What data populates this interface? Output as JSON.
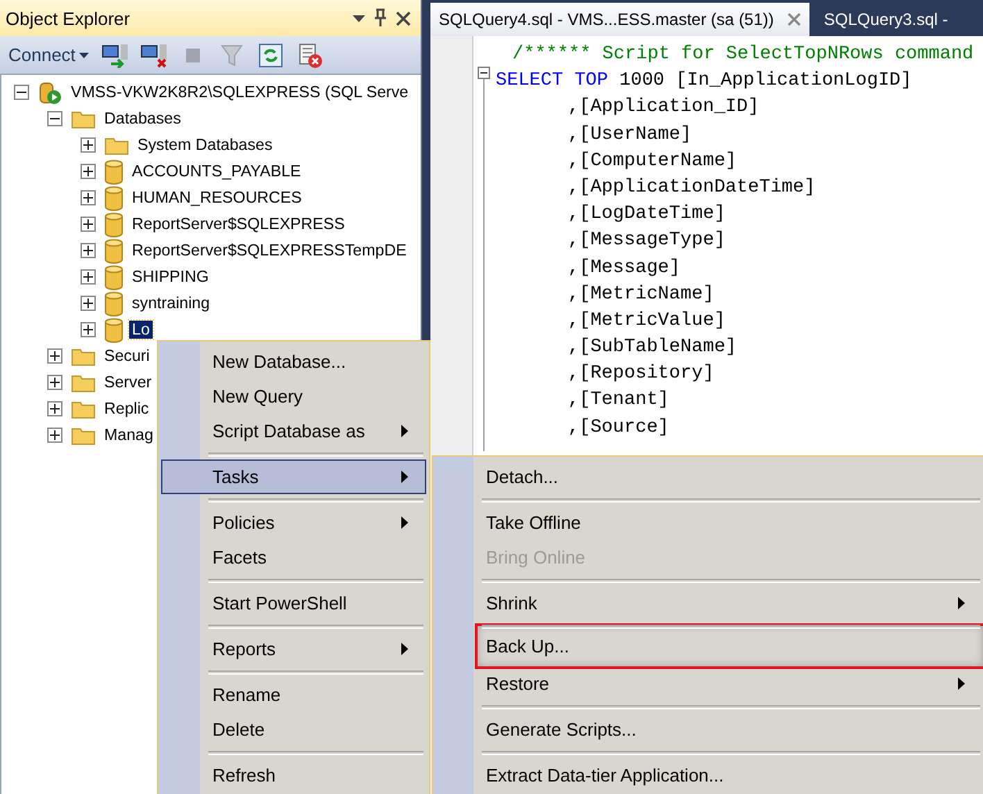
{
  "explorer": {
    "title": "Object Explorer",
    "connect_label": "Connect",
    "tree": [
      {
        "label": "VMSS-VKW2K8R2\\SQLEXPRESS (SQL Serve",
        "kind": "server",
        "expanded": true,
        "selected": false,
        "children": [
          {
            "label": "Databases",
            "kind": "folder",
            "expanded": true,
            "selected": false,
            "children": [
              {
                "label": "System Databases",
                "kind": "folder",
                "expanded": false,
                "selected": false
              },
              {
                "label": "ACCOUNTS_PAYABLE",
                "kind": "database",
                "expanded": false,
                "selected": false
              },
              {
                "label": "HUMAN_RESOURCES",
                "kind": "database",
                "expanded": false,
                "selected": false
              },
              {
                "label": "ReportServer$SQLEXPRESS",
                "kind": "database",
                "expanded": false,
                "selected": false
              },
              {
                "label": "ReportServer$SQLEXPRESSTempDE",
                "kind": "database",
                "expanded": false,
                "selected": false
              },
              {
                "label": "SHIPPING",
                "kind": "database",
                "expanded": false,
                "selected": false
              },
              {
                "label": "syntraining",
                "kind": "database",
                "expanded": false,
                "selected": false
              },
              {
                "label": "Lo",
                "kind": "database",
                "expanded": false,
                "selected": true
              }
            ]
          },
          {
            "label": "Securi",
            "kind": "folder",
            "expanded": false,
            "selected": false
          },
          {
            "label": "Server",
            "kind": "folder",
            "expanded": false,
            "selected": false
          },
          {
            "label": "Replic",
            "kind": "folder",
            "expanded": false,
            "selected": false
          },
          {
            "label": "Manag",
            "kind": "folder",
            "expanded": false,
            "selected": false
          }
        ]
      }
    ]
  },
  "tabs": [
    {
      "label": "SQLQuery4.sql - VMS...ESS.master (sa (51))",
      "selected": true
    },
    {
      "label": "SQLQuery3.sql -",
      "selected": false
    }
  ],
  "code": [
    {
      "kind": "plain",
      "tokens": [
        {
          "kind": "comment",
          "text": "/****** Script for SelectTopNRows command"
        }
      ]
    },
    {
      "kind": "first",
      "tokens": [
        {
          "kind": "keyword",
          "text": "SELECT TOP "
        },
        {
          "kind": "plain",
          "text": "1000 [In_ApplicationLogID]"
        }
      ]
    },
    {
      "kind": "column",
      "tokens": [
        {
          "kind": "plain",
          "text": ",[Application_ID]"
        }
      ]
    },
    {
      "kind": "column",
      "tokens": [
        {
          "kind": "plain",
          "text": ",[UserName]"
        }
      ]
    },
    {
      "kind": "column",
      "tokens": [
        {
          "kind": "plain",
          "text": ",[ComputerName]"
        }
      ]
    },
    {
      "kind": "column",
      "tokens": [
        {
          "kind": "plain",
          "text": ",[ApplicationDateTime]"
        }
      ]
    },
    {
      "kind": "column",
      "tokens": [
        {
          "kind": "plain",
          "text": ",[LogDateTime]"
        }
      ]
    },
    {
      "kind": "column",
      "tokens": [
        {
          "kind": "plain",
          "text": ",[MessageType]"
        }
      ]
    },
    {
      "kind": "column",
      "tokens": [
        {
          "kind": "plain",
          "text": ",[Message]"
        }
      ]
    },
    {
      "kind": "column",
      "tokens": [
        {
          "kind": "plain",
          "text": ",[MetricName]"
        }
      ]
    },
    {
      "kind": "column",
      "tokens": [
        {
          "kind": "plain",
          "text": ",[MetricValue]"
        }
      ]
    },
    {
      "kind": "column",
      "tokens": [
        {
          "kind": "plain",
          "text": ",[SubTableName]"
        }
      ]
    },
    {
      "kind": "column",
      "tokens": [
        {
          "kind": "plain",
          "text": ",[Repository]"
        }
      ]
    },
    {
      "kind": "column",
      "tokens": [
        {
          "kind": "plain",
          "text": ",[Tenant]"
        }
      ]
    },
    {
      "kind": "column",
      "tokens": [
        {
          "kind": "plain",
          "text": ",[Source]"
        }
      ]
    }
  ],
  "context_menu": [
    {
      "kind": "item",
      "label": "New Database...",
      "submenu": false,
      "selected": false
    },
    {
      "kind": "item",
      "label": "New Query",
      "submenu": false,
      "selected": false
    },
    {
      "kind": "item",
      "label": "Script Database as",
      "submenu": true,
      "selected": false
    },
    {
      "kind": "separator"
    },
    {
      "kind": "item",
      "label": "Tasks",
      "submenu": true,
      "selected": true
    },
    {
      "kind": "separator"
    },
    {
      "kind": "item",
      "label": "Policies",
      "submenu": true,
      "selected": false
    },
    {
      "kind": "item",
      "label": "Facets",
      "submenu": false,
      "selected": false
    },
    {
      "kind": "separator"
    },
    {
      "kind": "item",
      "label": "Start PowerShell",
      "submenu": false,
      "selected": false
    },
    {
      "kind": "separator"
    },
    {
      "kind": "item",
      "label": "Reports",
      "submenu": true,
      "selected": false
    },
    {
      "kind": "separator"
    },
    {
      "kind": "item",
      "label": "Rename",
      "submenu": false,
      "selected": false
    },
    {
      "kind": "item",
      "label": "Delete",
      "submenu": false,
      "selected": false
    },
    {
      "kind": "separator"
    },
    {
      "kind": "item",
      "label": "Refresh",
      "submenu": false,
      "selected": false
    }
  ],
  "tasks_menu": [
    {
      "kind": "item",
      "label": "Detach...",
      "submenu": false,
      "disabled": false,
      "annotated": false
    },
    {
      "kind": "separator"
    },
    {
      "kind": "item",
      "label": "Take Offline",
      "submenu": false,
      "disabled": false,
      "annotated": false
    },
    {
      "kind": "item",
      "label": "Bring Online",
      "submenu": false,
      "disabled": true,
      "annotated": false
    },
    {
      "kind": "separator"
    },
    {
      "kind": "item",
      "label": "Shrink",
      "submenu": true,
      "disabled": false,
      "annotated": false
    },
    {
      "kind": "separator"
    },
    {
      "kind": "item",
      "label": "Back Up...",
      "submenu": false,
      "disabled": false,
      "annotated": true
    },
    {
      "kind": "item",
      "label": "Restore",
      "submenu": true,
      "disabled": false,
      "annotated": false
    },
    {
      "kind": "separator"
    },
    {
      "kind": "item",
      "label": "Generate Scripts...",
      "submenu": false,
      "disabled": false,
      "annotated": false
    },
    {
      "kind": "separator"
    },
    {
      "kind": "item",
      "label": "Extract Data-tier Application...",
      "submenu": false,
      "disabled": false,
      "annotated": false
    }
  ]
}
